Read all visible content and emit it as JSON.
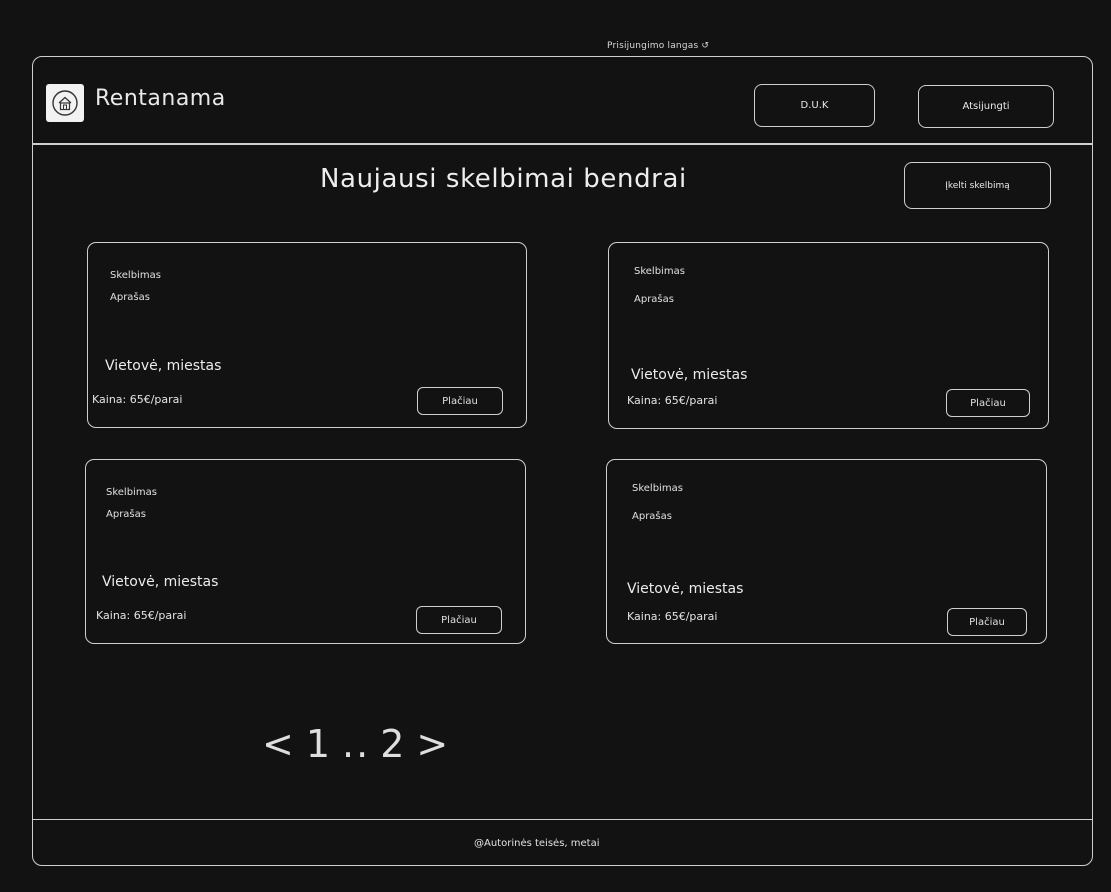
{
  "window": {
    "title": "Prisijungimo langas ↺"
  },
  "header": {
    "brand": "Rentanama",
    "duk_label": "D.U.K",
    "logout_label": "Atsijungti"
  },
  "main": {
    "title": "Naujausi skelbimai bendrai",
    "add_label": "Įkelti skelbimą",
    "listings": [
      {
        "title": "Skelbimas",
        "description": "Aprašas",
        "location": "Vietovė, miestas",
        "price": "Kaina: 65€/parai",
        "more_label": "Plačiau"
      },
      {
        "title": "Skelbimas",
        "description": "Aprašas",
        "location": "Vietovė, miestas",
        "price": "Kaina: 65€/parai",
        "more_label": "Plačiau"
      },
      {
        "title": "Skelbimas",
        "description": "Aprašas",
        "location": "Vietovė, miestas",
        "price": "Kaina: 65€/parai",
        "more_label": "Plačiau"
      },
      {
        "title": "Skelbimas",
        "description": "Aprašas",
        "location": "Vietovė, miestas",
        "price": "Kaina: 65€/parai",
        "more_label": "Plačiau"
      }
    ],
    "pagination": {
      "prev": "<",
      "first": "1",
      "ellipsis": "..",
      "last": "2",
      "next": ">"
    }
  },
  "footer": {
    "text": "@Autorinės teisės, metai"
  },
  "colors": {
    "background": "#121212",
    "stroke": "#cfcfcf",
    "text": "#e9e9e9"
  },
  "icons": {
    "logo": "house-circle-icon"
  }
}
